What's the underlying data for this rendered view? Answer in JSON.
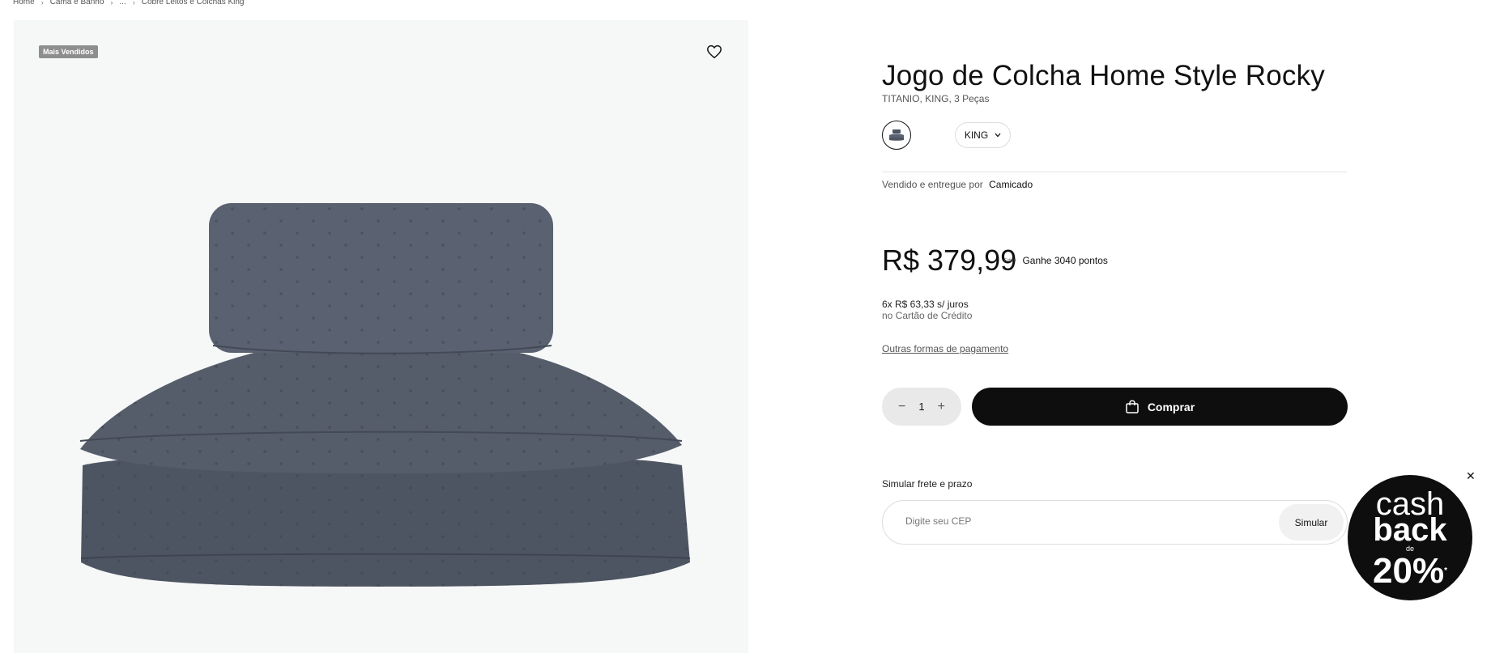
{
  "breadcrumb": [
    "Home",
    "Cama e Banho",
    "...",
    "Cobre Leitos e Colchas King"
  ],
  "gallery": {
    "badge": "Mais Vendidos"
  },
  "product": {
    "title": "Jogo de Colcha Home Style Rocky",
    "subtitle": "TITANIO, KING, 3 Peças",
    "size_selected": "KING",
    "seller_prefix": "Vendido e entregue por",
    "seller_name": "Camicado",
    "price": "R$ 379,99",
    "points_logo": "Esfera",
    "points_text": "Ganhe 3040 pontos",
    "installments": "6x R$ 63,33 s/ juros",
    "installments_sub": "no Cartão de Crédito",
    "other_payments": "Outras formas de pagamento",
    "quantity": "1",
    "buy_label": "Comprar"
  },
  "shipping": {
    "label": "Simular frete e prazo",
    "placeholder": "Digite seu CEP",
    "button": "Simular"
  },
  "cashback": {
    "line1": "cash",
    "line2": "back",
    "line3": "de",
    "line4": "20%",
    "asterisk": "*"
  },
  "colors": {
    "accent": "#0e0e0e",
    "badge": "#8e8e8e",
    "product": "#4e5562"
  }
}
